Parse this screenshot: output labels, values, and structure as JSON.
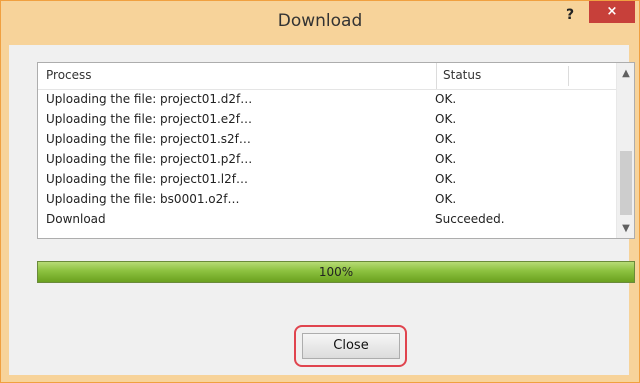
{
  "window": {
    "title": "Download",
    "help_label": "?",
    "close_label": "×"
  },
  "list": {
    "columns": [
      "Process",
      "Status"
    ],
    "rows": [
      {
        "process": "Uploading the file: project01.d2f…",
        "status": "OK."
      },
      {
        "process": "Uploading the file: project01.e2f…",
        "status": "OK."
      },
      {
        "process": "Uploading the file: project01.s2f…",
        "status": "OK."
      },
      {
        "process": "Uploading the file: project01.p2f…",
        "status": "OK."
      },
      {
        "process": "Uploading the file: project01.l2f…",
        "status": "OK."
      },
      {
        "process": "Uploading the file: bs0001.o2f…",
        "status": "OK."
      },
      {
        "process": "Download",
        "status": "Succeeded."
      }
    ]
  },
  "progress": {
    "label": "100%",
    "value": 1.0
  },
  "buttons": {
    "close": "Close"
  },
  "icons": {
    "scroll_up": "chevron-up-icon",
    "scroll_down": "chevron-down-icon"
  }
}
